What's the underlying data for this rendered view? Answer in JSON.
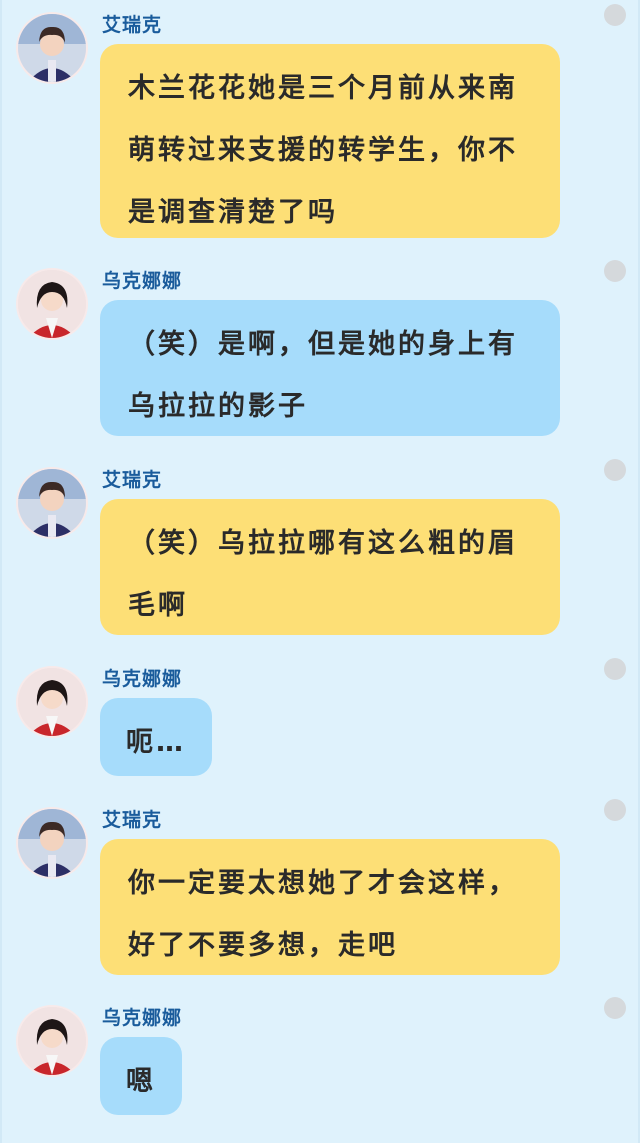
{
  "chat": {
    "messages": [
      {
        "sender": "艾瑞克",
        "text": "木兰花花她是三个月前从来南萌转过来支援的转学生，你不是调查清楚了吗",
        "color": "yellow"
      },
      {
        "sender": "乌克娜娜",
        "text": "（笑）是啊，但是她的身上有乌拉拉的影子",
        "color": "blue"
      },
      {
        "sender": "艾瑞克",
        "text": "（笑）乌拉拉哪有这么粗的眉毛啊",
        "color": "yellow"
      },
      {
        "sender": "乌克娜娜",
        "text": "呃…",
        "color": "blue"
      },
      {
        "sender": "艾瑞克",
        "text": "你一定要太想她了才会这样，好了不要多想，走吧",
        "color": "yellow"
      },
      {
        "sender": "乌克娜娜",
        "text": "嗯",
        "color": "blue"
      }
    ]
  },
  "colors": {
    "background": "#dff2fc",
    "bubble_yellow": "#fddf76",
    "bubble_blue": "#a6dcfb",
    "name": "#1a5c9c"
  }
}
